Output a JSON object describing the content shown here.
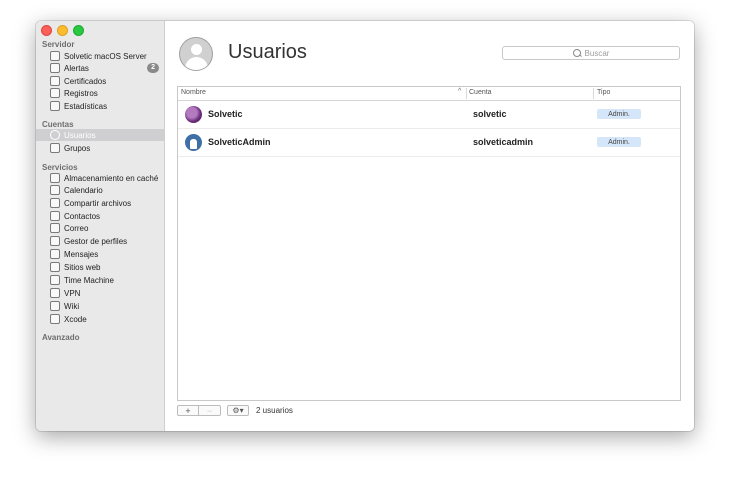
{
  "sidebar": {
    "server_title": "Servidor",
    "server_items": [
      {
        "label": "Solvetic macOS Server",
        "icon": "server-icon"
      },
      {
        "label": "Alertas",
        "icon": "alert-icon",
        "badge": "2"
      },
      {
        "label": "Certificados",
        "icon": "certificate-icon"
      },
      {
        "label": "Registros",
        "icon": "logs-icon"
      },
      {
        "label": "Estadísticas",
        "icon": "stats-icon"
      }
    ],
    "accounts_title": "Cuentas",
    "account_items": [
      {
        "label": "Usuarios",
        "icon": "user-icon",
        "selected": true
      },
      {
        "label": "Grupos",
        "icon": "group-icon"
      }
    ],
    "services_title": "Servicios",
    "service_items": [
      {
        "label": "Almacenamiento en caché",
        "icon": "cache-icon"
      },
      {
        "label": "Calendario",
        "icon": "calendar-icon"
      },
      {
        "label": "Compartir archivos",
        "icon": "file-sharing-icon"
      },
      {
        "label": "Contactos",
        "icon": "contacts-icon"
      },
      {
        "label": "Correo",
        "icon": "mail-icon"
      },
      {
        "label": "Gestor de perfiles",
        "icon": "profile-manager-icon"
      },
      {
        "label": "Mensajes",
        "icon": "messages-icon"
      },
      {
        "label": "Sitios web",
        "icon": "websites-icon"
      },
      {
        "label": "Time Machine",
        "icon": "time-machine-icon"
      },
      {
        "label": "VPN",
        "icon": "vpn-icon"
      },
      {
        "label": "Wiki",
        "icon": "wiki-icon"
      },
      {
        "label": "Xcode",
        "icon": "xcode-icon"
      }
    ],
    "advanced_title": "Avanzado"
  },
  "main": {
    "title": "Usuarios",
    "search_placeholder": "Buscar",
    "columns": {
      "name": "Nombre",
      "account": "Cuenta",
      "type": "Tipo"
    },
    "rows": [
      {
        "name": "Solvetic",
        "account": "solvetic",
        "type": "Admin."
      },
      {
        "name": "SolveticAdmin",
        "account": "solveticadmin",
        "type": "Admin."
      }
    ],
    "footer": {
      "add": "+",
      "remove": "−",
      "gear": "⚙▾",
      "count": "2 usuarios"
    }
  },
  "colors": {
    "selection": "#cfcfd2",
    "type_badge": "#d6e6fa"
  }
}
